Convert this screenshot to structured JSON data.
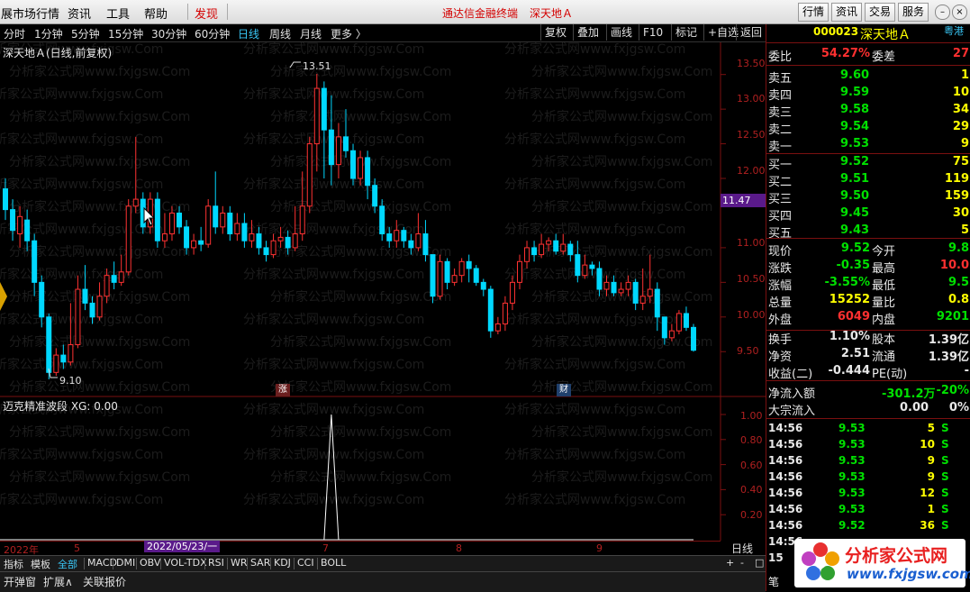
{
  "menubar": {
    "items": [
      "展市场行情",
      "资讯",
      "工具",
      "帮助"
    ],
    "discover": "发现",
    "app_title": "通达信金融终端",
    "stock_title": "深天地Ａ",
    "right_buttons": [
      "行情",
      "资讯",
      "交易",
      "服务"
    ]
  },
  "periodbar": {
    "periods": [
      "分时",
      "1分钟",
      "5分钟",
      "15分钟",
      "30分钟",
      "60分钟",
      "日线",
      "周线",
      "月线",
      "更多 〉"
    ],
    "active": "日线",
    "tools": [
      "复权",
      "叠加",
      "画线",
      "F10",
      "标记",
      "+自选",
      "返回"
    ]
  },
  "chart": {
    "title": "深天地Ａ(日线,前复权)",
    "high_label": "13.51",
    "low_label": "9.10",
    "current_tag": "11.47",
    "y_ticks": [
      "13.50",
      "13.00",
      "12.50",
      "12.00",
      "11.00",
      "10.50",
      "10.00",
      "9.50"
    ],
    "marker_zhang": "涨",
    "marker_cai": "财",
    "colors": {
      "up": "#ff3232",
      "down": "#00d8ff",
      "flat": "#ffffff"
    }
  },
  "chart_data": {
    "type": "candlestick",
    "ylim": [
      9.1,
      13.6
    ],
    "candles": [
      {
        "o": 11.85,
        "c": 11.55,
        "h": 12.0,
        "l": 11.4
      },
      {
        "o": 11.55,
        "c": 11.25,
        "h": 11.7,
        "l": 11.1
      },
      {
        "o": 11.2,
        "c": 11.45,
        "h": 11.6,
        "l": 11.0
      },
      {
        "o": 11.4,
        "c": 11.1,
        "h": 11.55,
        "l": 10.95
      },
      {
        "o": 11.1,
        "c": 10.5,
        "h": 11.2,
        "l": 10.3
      },
      {
        "o": 10.5,
        "c": 10.0,
        "h": 10.6,
        "l": 9.85
      },
      {
        "o": 10.0,
        "c": 9.2,
        "h": 10.05,
        "l": 9.1
      },
      {
        "o": 9.2,
        "c": 9.45,
        "h": 9.55,
        "l": 9.15
      },
      {
        "o": 9.45,
        "c": 9.35,
        "h": 9.6,
        "l": 9.25
      },
      {
        "o": 9.35,
        "c": 9.6,
        "h": 10.2,
        "l": 9.3
      },
      {
        "o": 9.6,
        "c": 10.4,
        "h": 10.6,
        "l": 9.55
      },
      {
        "o": 10.4,
        "c": 10.2,
        "h": 10.75,
        "l": 10.1
      },
      {
        "o": 10.2,
        "c": 10.0,
        "h": 10.3,
        "l": 9.9
      },
      {
        "o": 10.0,
        "c": 10.3,
        "h": 10.5,
        "l": 9.95
      },
      {
        "o": 10.3,
        "c": 10.6,
        "h": 10.7,
        "l": 10.2
      },
      {
        "o": 10.6,
        "c": 10.5,
        "h": 10.8,
        "l": 10.4
      },
      {
        "o": 10.5,
        "c": 10.65,
        "h": 10.9,
        "l": 10.45
      },
      {
        "o": 10.65,
        "c": 11.6,
        "h": 11.7,
        "l": 10.6
      },
      {
        "o": 11.6,
        "c": 11.7,
        "h": 12.6,
        "l": 11.5
      },
      {
        "o": 11.7,
        "c": 11.3,
        "h": 11.8,
        "l": 11.2
      },
      {
        "o": 11.3,
        "c": 11.7,
        "h": 11.8,
        "l": 11.2
      },
      {
        "o": 11.7,
        "c": 11.1,
        "h": 11.8,
        "l": 11.0
      },
      {
        "o": 11.1,
        "c": 11.2,
        "h": 11.5,
        "l": 11.0
      },
      {
        "o": 11.2,
        "c": 11.5,
        "h": 11.6,
        "l": 11.1
      },
      {
        "o": 11.5,
        "c": 11.3,
        "h": 11.6,
        "l": 11.2
      },
      {
        "o": 11.3,
        "c": 11.0,
        "h": 11.4,
        "l": 10.9
      },
      {
        "o": 11.0,
        "c": 11.1,
        "h": 11.2,
        "l": 10.9
      },
      {
        "o": 11.1,
        "c": 11.05,
        "h": 11.3,
        "l": 10.95
      },
      {
        "o": 11.05,
        "c": 11.6,
        "h": 11.7,
        "l": 11.0
      },
      {
        "o": 11.6,
        "c": 11.3,
        "h": 12.1,
        "l": 11.2
      },
      {
        "o": 11.3,
        "c": 11.5,
        "h": 11.6,
        "l": 11.2
      },
      {
        "o": 11.5,
        "c": 11.2,
        "h": 11.6,
        "l": 11.1
      },
      {
        "o": 11.2,
        "c": 11.35,
        "h": 11.5,
        "l": 11.1
      },
      {
        "o": 11.35,
        "c": 11.1,
        "h": 11.5,
        "l": 11.0
      },
      {
        "o": 11.1,
        "c": 11.2,
        "h": 11.4,
        "l": 11.0
      },
      {
        "o": 11.2,
        "c": 11.0,
        "h": 11.3,
        "l": 10.9
      },
      {
        "o": 11.0,
        "c": 10.9,
        "h": 11.1,
        "l": 10.8
      },
      {
        "o": 10.9,
        "c": 11.1,
        "h": 11.2,
        "l": 10.85
      },
      {
        "o": 11.1,
        "c": 11.15,
        "h": 11.3,
        "l": 11.0
      },
      {
        "o": 11.15,
        "c": 11.0,
        "h": 11.25,
        "l": 10.9
      },
      {
        "o": 11.0,
        "c": 11.2,
        "h": 11.6,
        "l": 10.95
      },
      {
        "o": 11.2,
        "c": 11.6,
        "h": 12.1,
        "l": 11.1
      },
      {
        "o": 11.6,
        "c": 12.5,
        "h": 12.6,
        "l": 11.5
      },
      {
        "o": 12.5,
        "c": 13.3,
        "h": 13.51,
        "l": 12.1
      },
      {
        "o": 13.3,
        "c": 12.7,
        "h": 13.4,
        "l": 12.0
      },
      {
        "o": 12.7,
        "c": 12.2,
        "h": 13.2,
        "l": 11.9
      },
      {
        "o": 12.2,
        "c": 12.6,
        "h": 12.8,
        "l": 12.0
      },
      {
        "o": 12.6,
        "c": 12.4,
        "h": 13.0,
        "l": 12.3
      },
      {
        "o": 12.4,
        "c": 12.0,
        "h": 12.5,
        "l": 11.9
      },
      {
        "o": 12.0,
        "c": 12.3,
        "h": 12.4,
        "l": 11.9
      },
      {
        "o": 12.3,
        "c": 11.9,
        "h": 12.4,
        "l": 11.7
      },
      {
        "o": 11.9,
        "c": 11.6,
        "h": 12.0,
        "l": 11.5
      },
      {
        "o": 11.6,
        "c": 11.2,
        "h": 11.7,
        "l": 11.1
      },
      {
        "o": 11.2,
        "c": 11.1,
        "h": 11.3,
        "l": 11.0
      },
      {
        "o": 11.1,
        "c": 11.25,
        "h": 11.4,
        "l": 11.0
      },
      {
        "o": 11.25,
        "c": 11.1,
        "h": 11.3,
        "l": 11.0
      },
      {
        "o": 11.1,
        "c": 11.0,
        "h": 11.2,
        "l": 10.9
      },
      {
        "o": 11.0,
        "c": 11.2,
        "h": 11.5,
        "l": 10.95
      },
      {
        "o": 11.2,
        "c": 10.9,
        "h": 11.4,
        "l": 10.8
      },
      {
        "o": 10.9,
        "c": 10.3,
        "h": 10.9,
        "l": 10.2
      },
      {
        "o": 10.3,
        "c": 10.8,
        "h": 10.9,
        "l": 10.25
      },
      {
        "o": 10.8,
        "c": 10.5,
        "h": 10.85,
        "l": 10.4
      },
      {
        "o": 10.5,
        "c": 10.6,
        "h": 10.7,
        "l": 10.45
      },
      {
        "o": 10.6,
        "c": 10.8,
        "h": 10.85,
        "l": 10.5
      },
      {
        "o": 10.8,
        "c": 10.7,
        "h": 10.9,
        "l": 10.5
      },
      {
        "o": 10.7,
        "c": 10.5,
        "h": 10.75,
        "l": 10.45
      },
      {
        "o": 10.5,
        "c": 10.4,
        "h": 10.55,
        "l": 10.3
      },
      {
        "o": 10.4,
        "c": 9.8,
        "h": 10.45,
        "l": 9.7
      },
      {
        "o": 9.8,
        "c": 9.9,
        "h": 10.0,
        "l": 9.75
      },
      {
        "o": 9.9,
        "c": 10.2,
        "h": 10.3,
        "l": 9.8
      },
      {
        "o": 10.2,
        "c": 10.5,
        "h": 10.6,
        "l": 10.1
      },
      {
        "o": 10.5,
        "c": 10.8,
        "h": 10.9,
        "l": 10.4
      },
      {
        "o": 10.8,
        "c": 11.0,
        "h": 11.1,
        "l": 10.7
      },
      {
        "o": 11.0,
        "c": 10.9,
        "h": 11.1,
        "l": 10.8
      },
      {
        "o": 10.9,
        "c": 11.05,
        "h": 11.2,
        "l": 10.85
      },
      {
        "o": 11.05,
        "c": 11.1,
        "h": 11.15,
        "l": 10.95
      },
      {
        "o": 11.1,
        "c": 10.95,
        "h": 11.2,
        "l": 10.9
      },
      {
        "o": 10.95,
        "c": 11.05,
        "h": 11.2,
        "l": 10.9
      },
      {
        "o": 11.05,
        "c": 10.9,
        "h": 11.1,
        "l": 10.8
      },
      {
        "o": 10.9,
        "c": 10.6,
        "h": 11.1,
        "l": 10.5
      },
      {
        "o": 10.6,
        "c": 10.75,
        "h": 10.9,
        "l": 10.55
      },
      {
        "o": 10.75,
        "c": 10.7,
        "h": 10.8,
        "l": 10.6
      },
      {
        "o": 10.7,
        "c": 10.4,
        "h": 10.8,
        "l": 10.3
      },
      {
        "o": 10.4,
        "c": 10.5,
        "h": 10.6,
        "l": 10.3
      },
      {
        "o": 10.5,
        "c": 10.35,
        "h": 10.6,
        "l": 10.3
      },
      {
        "o": 10.35,
        "c": 10.4,
        "h": 10.5,
        "l": 10.3
      },
      {
        "o": 10.4,
        "c": 10.5,
        "h": 10.6,
        "l": 10.3
      },
      {
        "o": 10.5,
        "c": 10.2,
        "h": 10.55,
        "l": 10.1
      },
      {
        "o": 10.2,
        "c": 10.3,
        "h": 10.7,
        "l": 10.1
      },
      {
        "o": 10.3,
        "c": 10.4,
        "h": 10.9,
        "l": 10.2
      },
      {
        "o": 10.4,
        "c": 10.0,
        "h": 10.5,
        "l": 9.8
      },
      {
        "o": 10.0,
        "c": 9.7,
        "h": 10.0,
        "l": 9.6
      },
      {
        "o": 9.7,
        "c": 9.8,
        "h": 9.9,
        "l": 9.65
      },
      {
        "o": 9.8,
        "c": 10.05,
        "h": 10.1,
        "l": 9.75
      },
      {
        "o": 10.05,
        "c": 9.85,
        "h": 10.15,
        "l": 9.8
      },
      {
        "o": 9.85,
        "c": 9.52,
        "h": 9.9,
        "l": 9.5
      }
    ]
  },
  "indicator": {
    "title": "迈克精准波段  XG: 0.00",
    "y_ticks": [
      "1.00",
      "0.80",
      "0.60",
      "0.40",
      "0.20"
    ],
    "signal_values": {
      "index": 45,
      "value": 1.0
    }
  },
  "timeaxis": {
    "labels": [
      "2022年",
      "5",
      "7",
      "8",
      "9"
    ],
    "cursor_date": "2022/05/23/一",
    "riline_button": "日线",
    "zoom": [
      "+",
      "-",
      "□"
    ]
  },
  "tabs": [
    "指标",
    "模板",
    "全部",
    "MACD",
    "DMI",
    "OBV",
    "VOL-TDX",
    "RSI",
    "WR",
    "SAR",
    "KDJ",
    "CCI",
    "BOLL"
  ],
  "tabs_active": "全部",
  "bottom": [
    "开弹窗",
    "扩展∧",
    "关联报价"
  ],
  "quote": {
    "code": "000023",
    "name": "深天地Ａ",
    "region": "粤港",
    "webi_label": "委比",
    "webi_value": "54.27%",
    "weicha_label": "委差",
    "weicha_value": "27",
    "sell": [
      {
        "label": "卖五",
        "price": "9.60",
        "vol": "1"
      },
      {
        "label": "卖四",
        "price": "9.59",
        "vol": "10"
      },
      {
        "label": "卖三",
        "price": "9.58",
        "vol": "34"
      },
      {
        "label": "卖二",
        "price": "9.54",
        "vol": "29"
      },
      {
        "label": "卖一",
        "price": "9.53",
        "vol": "9"
      }
    ],
    "buy": [
      {
        "label": "买一",
        "price": "9.52",
        "vol": "75"
      },
      {
        "label": "买二",
        "price": "9.51",
        "vol": "119"
      },
      {
        "label": "买三",
        "price": "9.50",
        "vol": "159"
      },
      {
        "label": "买四",
        "price": "9.45",
        "vol": "30"
      },
      {
        "label": "买五",
        "price": "9.43",
        "vol": "5"
      }
    ],
    "stats": [
      {
        "l1": "现价",
        "v1": "9.52",
        "c1": "green",
        "l2": "今开",
        "v2": "9.8",
        "c2": "green"
      },
      {
        "l1": "涨跌",
        "v1": "-0.35",
        "c1": "green",
        "l2": "最高",
        "v2": "10.0",
        "c2": "red"
      },
      {
        "l1": "涨幅",
        "v1": "-3.55%",
        "c1": "green",
        "l2": "最低",
        "v2": "9.5",
        "c2": "green"
      },
      {
        "l1": "总量",
        "v1": "15252",
        "c1": "yellow",
        "l2": "量比",
        "v2": "0.8",
        "c2": "yellow"
      },
      {
        "l1": "外盘",
        "v1": "6049",
        "c1": "red",
        "l2": "内盘",
        "v2": "9201",
        "c2": "green"
      }
    ],
    "stats2": [
      {
        "l1": "换手",
        "v1": "1.10%",
        "l2": "股本",
        "v2": "1.39亿"
      },
      {
        "l1": "净资",
        "v1": "2.51",
        "l2": "流通",
        "v2": "1.39亿"
      },
      {
        "l1": "收益(二)",
        "v1": "-0.444",
        "l2": "PE(动)",
        "v2": "-"
      }
    ],
    "netflow_label": "净流入额",
    "netflow_value": "-301.2万",
    "netflow_pct": "-20%",
    "bigtrade_label": "大宗流入",
    "bigtrade_v1": "0.00",
    "bigtrade_v2": "0%",
    "ticks": [
      {
        "t": "14:56",
        "p": "9.53",
        "q": "5",
        "s": "S"
      },
      {
        "t": "14:56",
        "p": "9.53",
        "q": "10",
        "s": "S"
      },
      {
        "t": "14:56",
        "p": "9.53",
        "q": "9",
        "s": "S"
      },
      {
        "t": "14:56",
        "p": "9.53",
        "q": "9",
        "s": "S"
      },
      {
        "t": "14:56",
        "p": "9.53",
        "q": "12",
        "s": "S"
      },
      {
        "t": "14:56",
        "p": "9.53",
        "q": "1",
        "s": "S"
      },
      {
        "t": "14:56",
        "p": "9.52",
        "q": "36",
        "s": "S"
      },
      {
        "t": "14:56",
        "p": "",
        "q": "",
        "s": ""
      },
      {
        "t": "15",
        "p": "",
        "q": "",
        "s": ""
      }
    ],
    "footer_char": "笔"
  },
  "logo": {
    "text": "分析家公式网",
    "url": "www.fxjgsw.com"
  },
  "watermark": "分析家公式网www.fxjgsw.Com"
}
